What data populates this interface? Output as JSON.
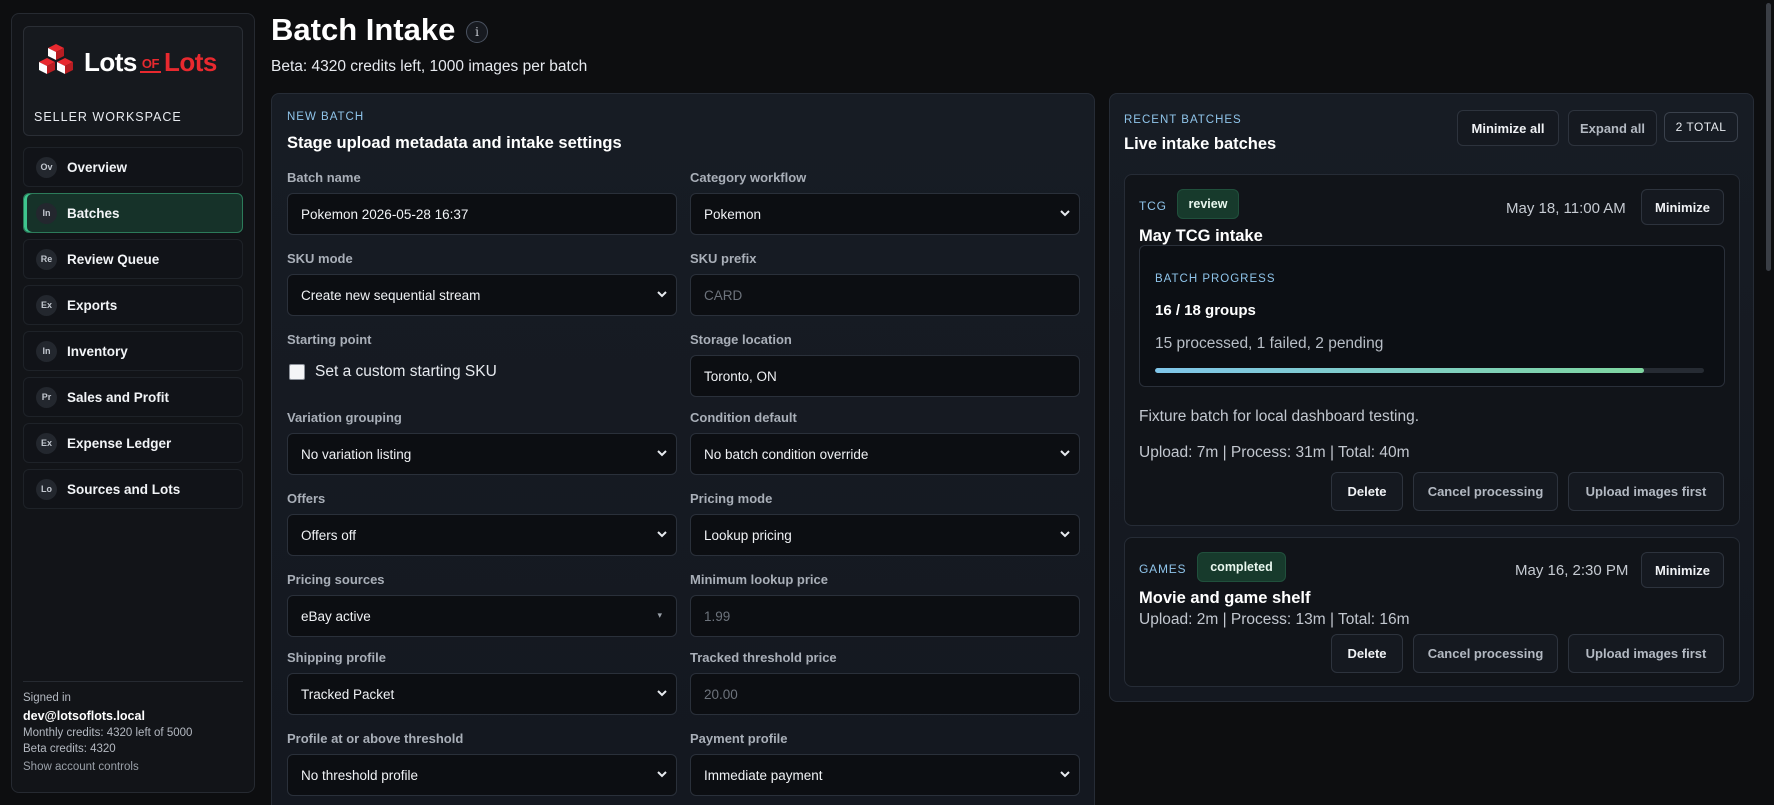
{
  "brand": {
    "word1": "Lots",
    "of": "OF",
    "word2": "Lots",
    "workspace": "SELLER WORKSPACE",
    "accent": "#e8292f"
  },
  "nav": [
    {
      "abbr": "Ov",
      "label": "Overview",
      "active": false
    },
    {
      "abbr": "In",
      "label": "Batches",
      "active": true
    },
    {
      "abbr": "Re",
      "label": "Review Queue",
      "active": false
    },
    {
      "abbr": "Ex",
      "label": "Exports",
      "active": false
    },
    {
      "abbr": "In",
      "label": "Inventory",
      "active": false
    },
    {
      "abbr": "Pr",
      "label": "Sales and Profit",
      "active": false
    },
    {
      "abbr": "Ex",
      "label": "Expense Ledger",
      "active": false
    },
    {
      "abbr": "Lo",
      "label": "Sources and Lots",
      "active": false
    }
  ],
  "account": {
    "signed_in_label": "Signed in",
    "email": "dev@lotsoflots.local",
    "monthly": "Monthly credits: 4320 left of 5000",
    "beta": "Beta credits: 4320",
    "controls": "Show account controls"
  },
  "header": {
    "title": "Batch Intake",
    "info_glyph": "i",
    "subtitle": "Beta: 4320 credits left, 1000 images per batch"
  },
  "new_batch": {
    "eyebrow": "NEW BATCH",
    "title": "Stage upload metadata and intake settings",
    "batch_name": {
      "label": "Batch name",
      "value": "Pokemon 2026-05-28 16:37"
    },
    "category_workflow": {
      "label": "Category workflow",
      "value": "Pokemon"
    },
    "sku_mode": {
      "label": "SKU mode",
      "value": "Create new sequential stream"
    },
    "sku_prefix": {
      "label": "SKU prefix",
      "placeholder": "CARD"
    },
    "starting_point": {
      "label": "Starting point",
      "checkbox_label": "Set a custom starting SKU"
    },
    "storage_location": {
      "label": "Storage location",
      "value": "Toronto, ON"
    },
    "variation_grouping": {
      "label": "Variation grouping",
      "value": "No variation listing"
    },
    "condition_default": {
      "label": "Condition default",
      "value": "No batch condition override"
    },
    "offers": {
      "label": "Offers",
      "value": "Offers off"
    },
    "pricing_mode": {
      "label": "Pricing mode",
      "value": "Lookup pricing"
    },
    "pricing_sources": {
      "label": "Pricing sources",
      "value": "eBay active"
    },
    "min_lookup_price": {
      "label": "Minimum lookup price",
      "placeholder": "1.99"
    },
    "shipping_profile": {
      "label": "Shipping profile",
      "value": "Tracked Packet"
    },
    "tracked_threshold": {
      "label": "Tracked threshold price",
      "placeholder": "20.00"
    },
    "profile_above": {
      "label": "Profile at or above threshold",
      "value": "No threshold profile"
    },
    "payment_profile": {
      "label": "Payment profile",
      "value": "Immediate payment"
    }
  },
  "recent": {
    "eyebrow": "RECENT BATCHES",
    "title": "Live intake batches",
    "minimize_all": "Minimize all",
    "expand_all": "Expand all",
    "total": "2 TOTAL",
    "batches": [
      {
        "tag": "TCG",
        "status": "review",
        "date": "May 18, 11:00 AM",
        "minimize": "Minimize",
        "name": "May TCG intake",
        "progress_label": "BATCH PROGRESS",
        "groups": "16 / 18 groups",
        "summary": "15 processed, 1 failed, 2 pending",
        "progress": 0.89,
        "note": "Fixture batch for local dashboard testing.",
        "timing": "Upload: 7m | Process: 31m | Total: 40m",
        "delete": "Delete",
        "cancel": "Cancel processing",
        "upload": "Upload images first"
      },
      {
        "tag": "GAMES",
        "status": "completed",
        "date": "May 16, 2:30 PM",
        "minimize": "Minimize",
        "name": "Movie and game shelf",
        "timing": "Upload: 2m | Process: 13m | Total: 16m",
        "delete": "Delete",
        "cancel": "Cancel processing",
        "upload": "Upload images first"
      }
    ]
  },
  "colors": {
    "active_nav": "#3ec58e",
    "eyebrow": "#8fc4ea",
    "status_bg": "#173a2c"
  }
}
